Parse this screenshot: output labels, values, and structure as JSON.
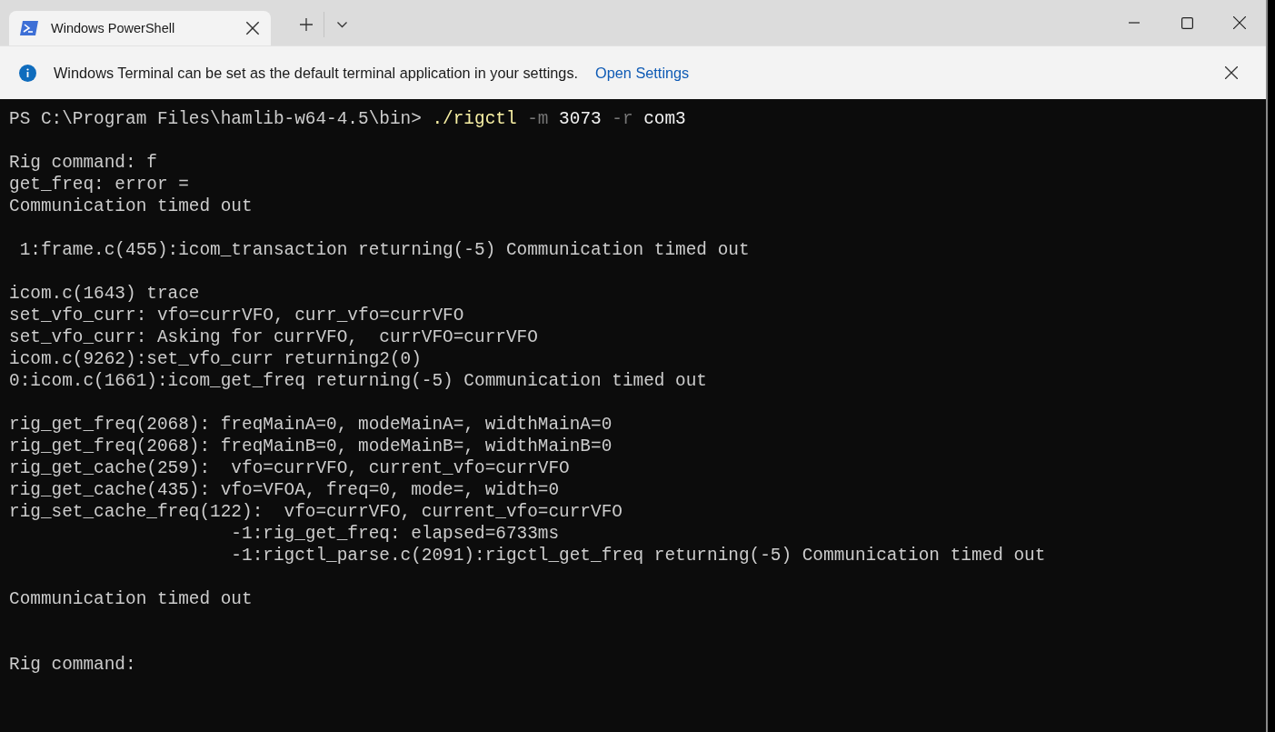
{
  "tabs": [
    {
      "title": "Windows PowerShell",
      "selected": true
    }
  ],
  "infobar": {
    "message": "Windows Terminal can be set as the default terminal application in your settings.",
    "link": "Open Settings"
  },
  "terminal": {
    "blocks": [
      {
        "kind": "command",
        "lines": [
          [
            {
              "kind": "path",
              "text": "PS C:\\Program Files\\hamlib-w64-4.5\\bin> "
            },
            {
              "kind": "program",
              "text": "./rigctl"
            },
            {
              "kind": "flag",
              "text": " -m"
            },
            {
              "kind": "argument",
              "text": " 3073"
            },
            {
              "kind": "flag",
              "text": " -r"
            },
            {
              "kind": "argument",
              "text": " com3"
            }
          ]
        ]
      },
      {
        "kind": "output",
        "lines": [
          "Rig command: f",
          "get_freq: error =",
          "Communication timed out"
        ]
      },
      {
        "kind": "output",
        "lines": [
          " 1:frame.c(455):icom_transaction returning(-5) Communication timed out"
        ]
      },
      {
        "kind": "output",
        "lines": [
          "icom.c(1643) trace",
          "set_vfo_curr: vfo=currVFO, curr_vfo=currVFO",
          "set_vfo_curr: Asking for currVFO,  currVFO=currVFO",
          "icom.c(9262):set_vfo_curr returning2(0)",
          "0:icom.c(1661):icom_get_freq returning(-5) Communication timed out"
        ]
      },
      {
        "kind": "output",
        "lines": [
          "rig_get_freq(2068): freqMainA=0, modeMainA=, widthMainA=0",
          "rig_get_freq(2068): freqMainB=0, modeMainB=, widthMainB=0",
          "rig_get_cache(259):  vfo=currVFO, current_vfo=currVFO",
          "rig_get_cache(435): vfo=VFOA, freq=0, mode=, width=0",
          "rig_set_cache_freq(122):  vfo=currVFO, current_vfo=currVFO",
          "                     -1:rig_get_freq: elapsed=6733ms",
          "                     -1:rigctl_parse.c(2091):rigctl_get_freq returning(-5) Communication timed out"
        ]
      },
      {
        "kind": "output",
        "lines": [
          "Communication timed out"
        ]
      },
      {
        "kind": "prompt",
        "lines": [
          "Rig command:"
        ]
      }
    ]
  }
}
